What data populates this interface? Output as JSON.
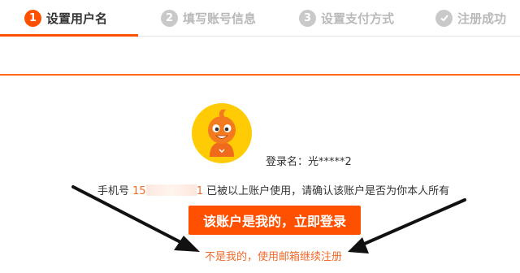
{
  "steps": [
    {
      "num": "1",
      "label": "设置用户名"
    },
    {
      "num": "2",
      "label": "填写账号信息"
    },
    {
      "num": "3",
      "label": "设置支付方式"
    },
    {
      "label": "注册成功"
    }
  ],
  "account": {
    "login_label": "登录名：光*****2",
    "phone_prefix": "手机号",
    "phone_start": "15",
    "phone_end": "1",
    "phone_notice": "已被以上账户使用，请确认该账户是否为你本人所有"
  },
  "actions": {
    "login_button": "该账户是我的，立即登录",
    "not_mine_link": "不是我的，使用邮箱继续注册"
  },
  "colors": {
    "accent": "#ff5000",
    "link": "#f36a2b"
  }
}
